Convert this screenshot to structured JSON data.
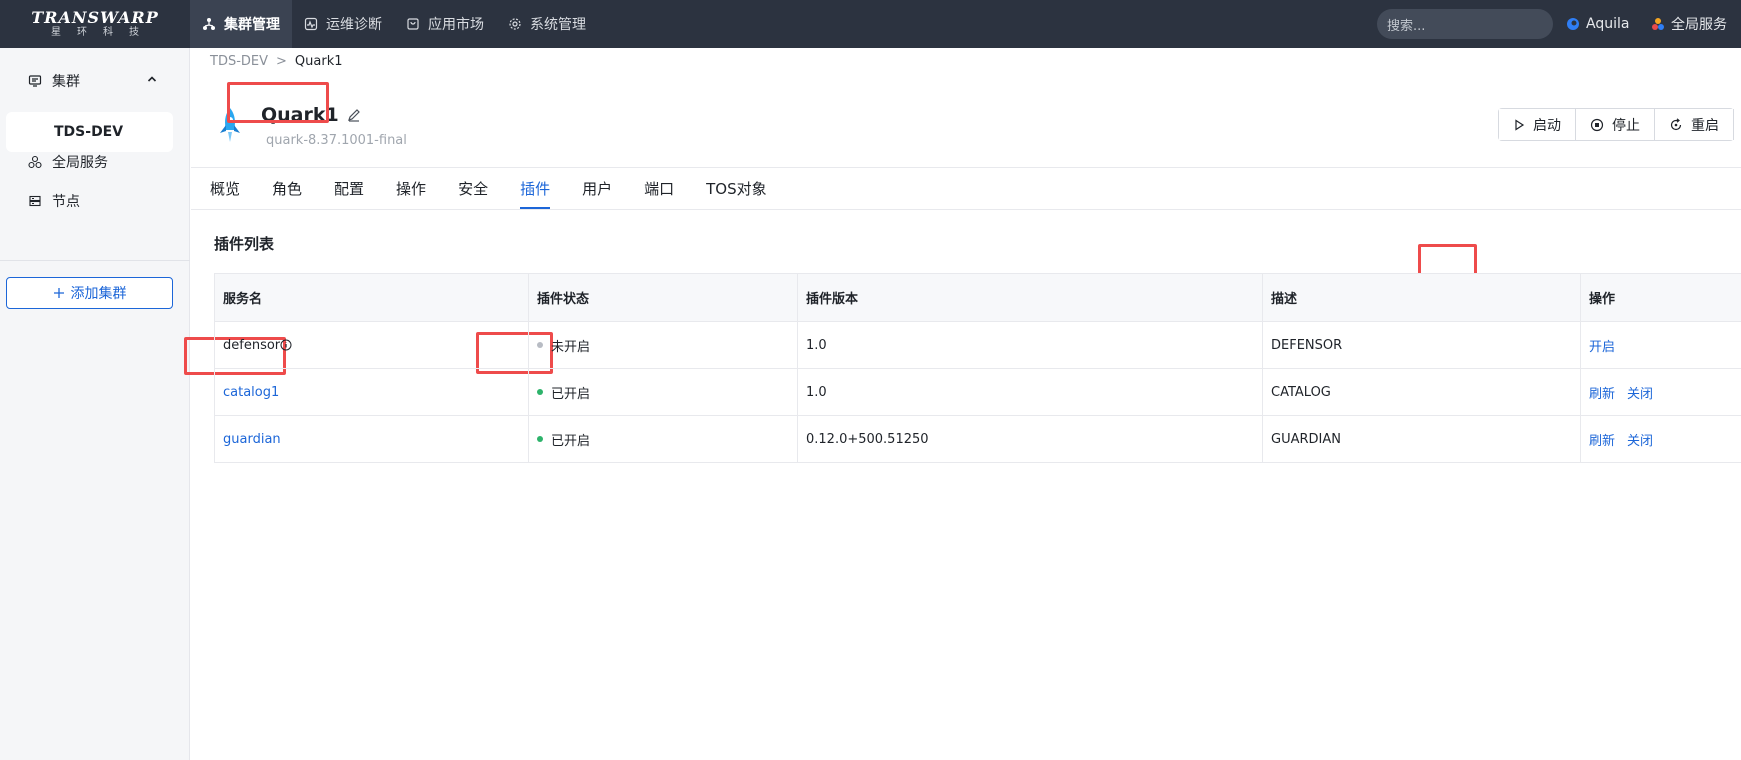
{
  "topbar": {
    "brand": "TRANSWARP",
    "brand_sub": "星环科技",
    "nav": [
      {
        "label": "集群管理",
        "icon": "cluster-icon"
      },
      {
        "label": "运维诊断",
        "icon": "diagnose-icon"
      },
      {
        "label": "应用市场",
        "icon": "market-icon"
      },
      {
        "label": "系统管理",
        "icon": "gear-icon"
      }
    ],
    "search_placeholder": "搜索...",
    "user": "Aquila",
    "global_service": "全局服务"
  },
  "sidebar": {
    "group_label": "集群",
    "cluster_name": "TDS-DEV",
    "items": [
      {
        "label": "全局服务",
        "icon": "services-icon"
      },
      {
        "label": "节点",
        "icon": "nodes-icon"
      }
    ],
    "add_cluster": "添加集群"
  },
  "breadcrumb": {
    "root": "TDS-DEV",
    "separator": ">",
    "current": "Quark1"
  },
  "service": {
    "name": "Quark1",
    "version": "quark-8.37.1001-final"
  },
  "actions": {
    "start": "启动",
    "stop": "停止",
    "restart": "重启"
  },
  "tabs": [
    "概览",
    "角色",
    "配置",
    "操作",
    "安全",
    "插件",
    "用户",
    "端口",
    "TOS对象"
  ],
  "plugins": {
    "title": "插件列表",
    "columns": [
      "服务名",
      "插件状态",
      "插件版本",
      "描述",
      "操作"
    ],
    "rows": [
      {
        "name": "defensor",
        "status": "未开启",
        "version": "1.0",
        "desc": "DEFENSOR",
        "ops": [
          "开启"
        ]
      },
      {
        "name": "catalog1",
        "status": "已开启",
        "version": "1.0",
        "desc": "CATALOG",
        "ops": [
          "刷新",
          "关闭"
        ]
      },
      {
        "name": "guardian",
        "status": "已开启",
        "version": "0.12.0+500.51250",
        "desc": "GUARDIAN",
        "ops": [
          "刷新",
          "关闭"
        ]
      }
    ]
  },
  "colors": {
    "topbar_bg": "#2c3340",
    "accent": "#1c66d8",
    "status_on": "#2db36b",
    "status_off": "#b8bcc4",
    "annotation": "#ee4b4b"
  }
}
